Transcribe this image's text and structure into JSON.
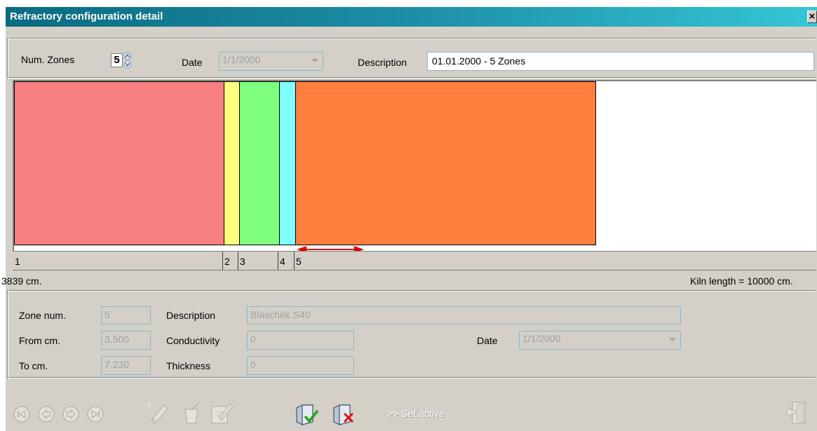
{
  "window": {
    "title": "Refractory configuration detail",
    "close_symbol": "×"
  },
  "header": {
    "num_zones_label": "Num. Zones",
    "num_zones_value": "5",
    "date_label": "Date",
    "date_value": "1/1/2000",
    "description_label": "Description",
    "description_value": "01.01.2000 - 5 Zones"
  },
  "zones_graph": {
    "zones": [
      {
        "label": "1",
        "color": "#f77f7f",
        "from_cm": 0,
        "to_cm": 2630
      },
      {
        "label": "2",
        "color": "#ffff7f",
        "from_cm": 2630,
        "to_cm": 2830
      },
      {
        "label": "3",
        "color": "#7fff7f",
        "from_cm": 2830,
        "to_cm": 3330
      },
      {
        "label": "4",
        "color": "#7fffff",
        "from_cm": 3330,
        "to_cm": 3530
      },
      {
        "label": "5",
        "color": "#ff7f3f",
        "from_cm": 3530,
        "to_cm": 7300
      }
    ],
    "position_text": "3839 cm.",
    "kiln_length_text": "Kiln length = 10000 cm.",
    "resize_arrow_color": "#e00000"
  },
  "details": {
    "zone_num_label": "Zone num.",
    "zone_num_value": "5",
    "description_label": "Description",
    "description_value": "Blaschek S40",
    "from_label": "From cm.",
    "from_value": "3.500",
    "conductivity_label": "Conductivity",
    "conductivity_value": "0",
    "date_label": "Date",
    "date_value": "1/1/2000",
    "to_label": "To cm.",
    "to_value": "7.230",
    "thickness_label": "Thickness",
    "thickness_value": "0"
  },
  "toolbar": {
    "icons": [
      "first-record-icon",
      "previous-record-icon",
      "next-record-icon",
      "last-record-icon",
      "new-record-icon",
      "delete-record-icon",
      "edit-record-icon",
      "confirm-icon",
      "cancel-icon",
      "exit-icon"
    ],
    "set_active_label": "Set active",
    "set_active_prefix": ">>"
  }
}
